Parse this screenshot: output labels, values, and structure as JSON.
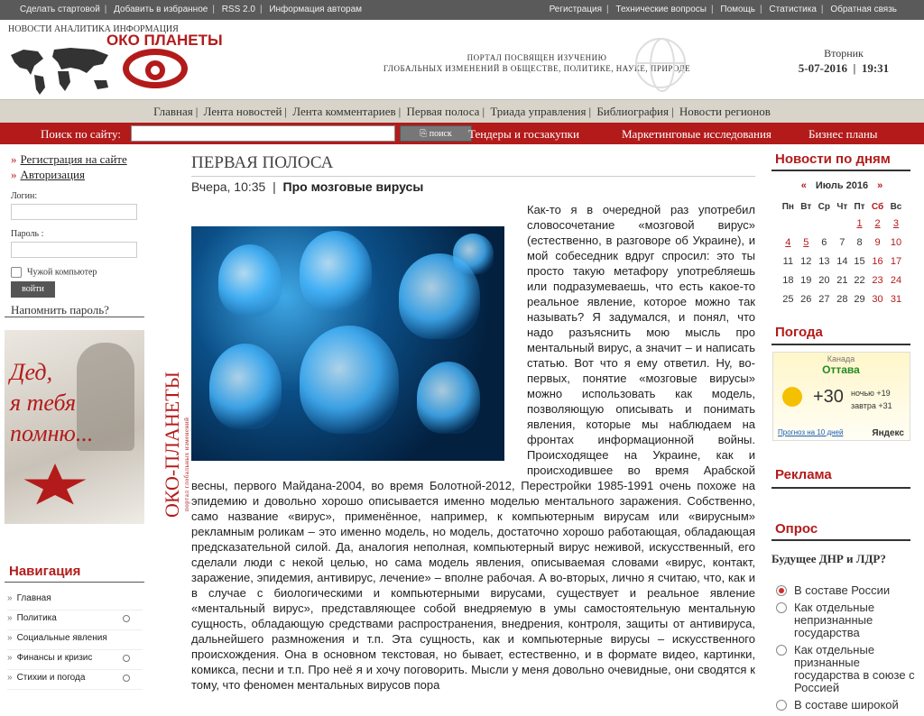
{
  "top": {
    "left_links": [
      "Сделать стартовой",
      "Добавить в избранное",
      "RSS 2.0",
      "Информация авторам"
    ],
    "right_links": [
      "Регистрация",
      "Технические вопросы",
      "Помощь",
      "Статистика",
      "Обратная связь"
    ]
  },
  "header": {
    "tagline": "НОВОСТИ АНАЛИТИКА ИНФОРМАЦИЯ",
    "logo": "ОКО ПЛАНЕТЫ",
    "portal_line1": "ПОРТАЛ ПОСВЯЩЕН ИЗУЧЕНИЮ",
    "portal_line2": "ГЛОБАЛЬНЫХ ИЗМЕНЕНИЙ В ОБЩЕСТВЕ, ПОЛИТИКЕ, НАУКЕ, ПРИРОДЕ",
    "day": "Вторник",
    "date": "5-07-2016",
    "time": "19:31"
  },
  "menu": [
    "Главная",
    "Лента новостей",
    "Лента комментариев",
    "Первая полоса",
    "Триада управления",
    "Библиография",
    "Новости регионов"
  ],
  "search": {
    "label": "Поиск по сайту:",
    "placeholder": "",
    "button": "поиск",
    "links": [
      "Тендеры и госзакупки",
      "Маркетинговые исследования",
      "Бизнес планы"
    ]
  },
  "left": {
    "register": "Регистрация на сайте",
    "auth": "Авторизация",
    "login_label": "Логин:",
    "password_label": "Пароль :",
    "foreign": "Чужой компьютер",
    "login_button": "войти",
    "remind": "Напомнить пароль?",
    "banner_text": [
      "Дед,",
      "я тебя",
      "помню..."
    ],
    "nav_title": "Навигация",
    "nav": [
      "Главная",
      "Политика",
      "Социальные явления",
      "Финансы и кризис",
      "Стихии и погода"
    ],
    "vertical_logo": "ОКО-ПЛАНЕТЫ",
    "vertical_sub": "портал глобальных изменений"
  },
  "article": {
    "section": "ПЕРВАЯ ПОЛОСА",
    "date": "Вчера, 10:35",
    "title": "Про мозговые вирусы",
    "text": "Как-то я в очередной раз употребил словосочетание «мозговой вирус» (естественно, в разговоре об Украине), и мой собеседник вдруг спросил: это ты просто такую метафору употребляешь или подразумеваешь, что есть какое-то реальное явление, которое можно так называть? Я задумался, и понял, что надо разъяснить мою мысль про ментальный вирус, а значит – и написать статью. Вот что я ему ответил. Ну, во-первых, понятие «мозговые вирусы» можно использовать как модель, позволяющую описывать и понимать явления, которые мы наблюдаем на фронтах информационной войны. Происходящее на Украине, как и происходившее во время Арабской весны, первого Майдана-2004, во время Болотной-2012, Перестройки 1985-1991 очень похоже на эпидемию и довольно хорошо описывается именно моделью ментального заражения. Собственно, само название «вирус», применённое, например, к компьютерным вирусам или «вирусным» рекламным роликам – это именно модель, но модель, достаточно хорошо работающая, обладающая предсказательной силой. Да, аналогия неполная, компьютерный вирус неживой, искусственный, его сделали люди с некой целью, но сама модель явления, описываемая словами «вирус, контакт, заражение, эпидемия, антивирус, лечение» – вполне рабочая. А во-вторых, лично я считаю, что, как и в случае с биологическими и компьютерными вирусами, существует и реальное явление «ментальный вирус», представляющее собой внедряемую в умы самостоятельную ментальную сущность, обладающую средствами распространения, внедрения, контроля, защиты от антивируса, дальнейшего размножения и т.п. Эта сущность, как и компьютерные вирусы – искусственного происхождения. Она в основном текстовая, но бывает, естественно, и в формате видео, картинки, комикса, песни и т.п. Про неё я и хочу поговорить. Мысли у меня довольно очевидные, они сводятся к тому, что феномен ментальных вирусов пора"
  },
  "right": {
    "news_title": "Новости по дням",
    "cal_month": "Июль 2016",
    "cal_prev": "«",
    "cal_next": "»",
    "weekdays": [
      "Пн",
      "Вт",
      "Ср",
      "Чт",
      "Пт",
      "Сб",
      "Вс"
    ],
    "weeks": [
      [
        "",
        "",
        "",
        "",
        "1",
        "2",
        "3"
      ],
      [
        "4",
        "5",
        "6",
        "7",
        "8",
        "9",
        "10"
      ],
      [
        "11",
        "12",
        "13",
        "14",
        "15",
        "16",
        "17"
      ],
      [
        "18",
        "19",
        "20",
        "21",
        "22",
        "23",
        "24"
      ],
      [
        "25",
        "26",
        "27",
        "28",
        "29",
        "30",
        "31"
      ]
    ],
    "weather_title": "Погода",
    "weather_region": "Канада",
    "weather_city": "Оттава",
    "weather_temp": "+30",
    "weather_night": "ночью +19",
    "weather_tomorrow": "завтра +31",
    "weather_forecast": "Прогноз на 10 дней",
    "weather_brand": "Яндекс",
    "ads_title": "Реклама",
    "poll_title": "Опрос",
    "poll_question": "Будущее ДНР и ЛДР?",
    "poll_options": [
      "В составе России",
      "Как отдельные непризнанные государства",
      "Как отдельные признанные государства в союзе с Россией",
      "В составе широкой"
    ]
  }
}
